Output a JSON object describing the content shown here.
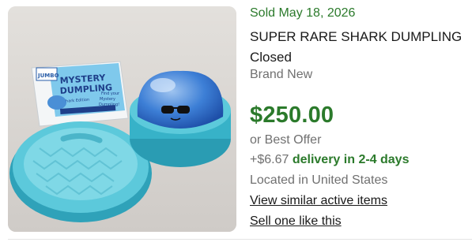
{
  "listing": {
    "sold_date": "Sold May 18, 2026",
    "title_line1": "SUPER RARE SHARK DUMPLING",
    "title_line2": "Closed",
    "condition": "Brand New",
    "price": "$250.00",
    "best_offer": "or Best Offer",
    "shipping_cost": "+$6.67",
    "delivery_text": "delivery in 2-4 days",
    "location": "Located in United States",
    "view_similar": "View similar active items",
    "sell_one": "Sell one like this"
  },
  "package_text": {
    "brand": "JUMBO",
    "name_line1": "MYSTERY",
    "name_line2": "DUMPLING",
    "edition": "Shark Edition",
    "side_line1": "Find your",
    "side_line2": "Mystery",
    "side_line3": "Dumpling!"
  },
  "colors": {
    "accent_green": "#2b7a2b",
    "muted_text": "#707070",
    "primary_text": "#191919"
  }
}
